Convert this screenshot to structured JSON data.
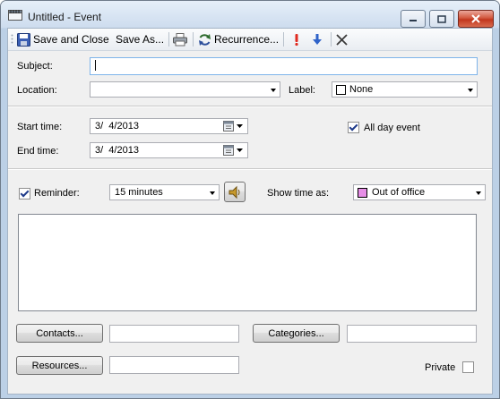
{
  "window": {
    "title": "Untitled - Event"
  },
  "toolbar": {
    "save_close": "Save and Close",
    "save_as": "Save As...",
    "recurrence": "Recurrence..."
  },
  "fields": {
    "subject_label": "Subject:",
    "subject_value": "",
    "location_label": "Location:",
    "location_value": "",
    "label_label": "Label:",
    "label_value": "None",
    "start_label": "Start time:",
    "start_value": "3/  4/2013",
    "end_label": "End time:",
    "end_value": "3/  4/2013",
    "all_day_label": "All day event",
    "all_day_checked": true,
    "reminder_label": "Reminder:",
    "reminder_checked": true,
    "reminder_value": "15 minutes",
    "show_as_label": "Show time as:",
    "show_as_value": "Out of office",
    "show_as_color": "#e68ee6",
    "notes": ""
  },
  "buttons": {
    "contacts": "Contacts...",
    "categories": "Categories...",
    "resources": "Resources..."
  },
  "private": {
    "label": "Private",
    "checked": false
  }
}
